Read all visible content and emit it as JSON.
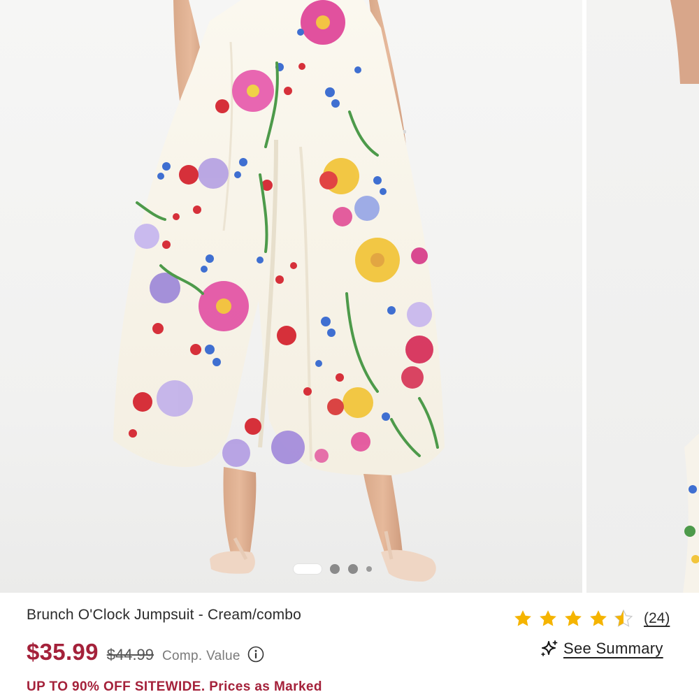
{
  "product": {
    "title": "Brunch O'Clock Jumpsuit - Cream/combo",
    "price": "$35.99",
    "original_price": "$44.99",
    "comp_value_label": "Comp. Value",
    "rating": 4.5,
    "rating_max": 5,
    "review_count": "(24)",
    "see_summary_label": "See Summary",
    "promo": "UP TO 90% OFF SITEWIDE. Prices as Marked"
  },
  "carousel": {
    "current_index": 1,
    "visible_dots": 4
  },
  "icons": {
    "info": "info-circle-icon",
    "sparkle": "ai-sparkle-icon",
    "star_full": "star-filled-icon",
    "star_half": "star-half-icon"
  },
  "colors": {
    "price_red": "#a4213a",
    "star_gold": "#f5b400",
    "background": "#ffffff"
  }
}
